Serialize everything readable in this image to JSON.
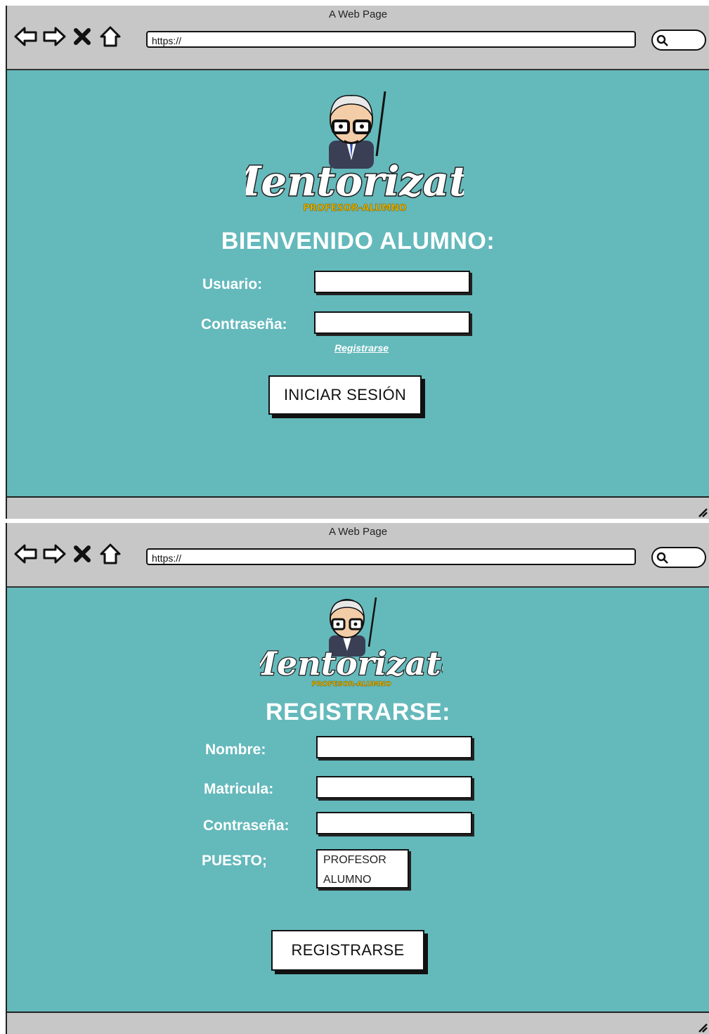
{
  "login_window": {
    "title": "A Web Page",
    "url": "https://",
    "logo_text": "Mentorizate",
    "logo_subtitle": "PROFESOR-ALUMNO",
    "heading": "BIENVENIDO ALUMNO:",
    "usuario_label": "Usuario:",
    "usuario_value": "",
    "password_label": "Contraseña:",
    "password_value": "",
    "register_link": "Registrarse",
    "submit_label": "INICIAR SESIÓN"
  },
  "register_window": {
    "title": "A Web Page",
    "url": "https://",
    "logo_text": "Mentorizate",
    "logo_subtitle": "PROFESOR-ALUMNO",
    "heading": "REGISTRARSE:",
    "nombre_label": "Nombre:",
    "nombre_value": "",
    "matricula_label": "Matricula:",
    "matricula_value": "",
    "password_label": "Contraseña:",
    "password_value": "",
    "puesto_label": "PUESTO;",
    "puesto_options": [
      "PROFESOR",
      "ALUMNO"
    ],
    "submit_label": "REGISTRARSE"
  },
  "colors": {
    "content_bg": "#64b9bb",
    "chrome_bg": "#c7c7c7"
  },
  "icons": [
    "back-arrow-icon",
    "forward-arrow-icon",
    "close-icon",
    "home-icon",
    "search-icon",
    "resize-grip-icon"
  ]
}
